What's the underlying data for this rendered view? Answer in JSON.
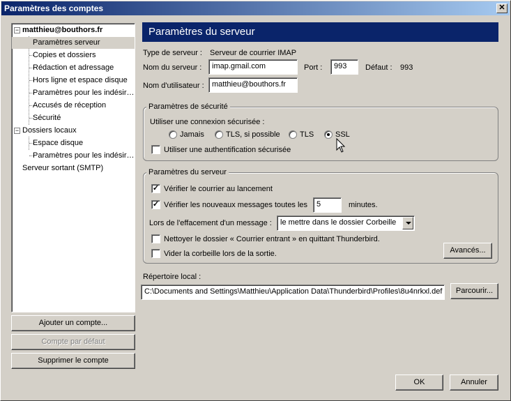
{
  "window": {
    "title": "Paramètres des comptes",
    "close_label": "✕"
  },
  "sidebar": {
    "account": "matthieu@bouthors.fr",
    "account_items": [
      "Paramètres serveur",
      "Copies et dossiers",
      "Rédaction et adressage",
      "Hors ligne et espace disque",
      "Paramètres pour les indésir…",
      "Accusés de réception",
      "Sécurité"
    ],
    "local_folders": "Dossiers locaux",
    "local_items": [
      "Espace disque",
      "Paramètres pour les indésir…"
    ],
    "smtp": "Serveur sortant (SMTP)",
    "add_account": "Ajouter un compte...",
    "default_account": "Compte par défaut",
    "delete_account": "Supprimer le compte"
  },
  "main": {
    "header": "Paramètres du serveur",
    "server_type_label": "Type de serveur :",
    "server_type_value": "Serveur de courrier IMAP",
    "server_name_label": "Nom du serveur :",
    "server_name_value": "imap.gmail.com",
    "port_label": "Port :",
    "port_value": "993",
    "default_label": "Défaut :",
    "default_value": "993",
    "username_label": "Nom d'utilisateur :",
    "username_value": "matthieu@bouthors.fr",
    "security": {
      "title": "Paramètres de sécurité",
      "connection_label": "Utiliser une connexion sécurisée :",
      "options": [
        "Jamais",
        "TLS, si possible",
        "TLS",
        "SSL"
      ],
      "selected": "SSL",
      "secure_auth_label": "Utiliser une authentification sécurisée",
      "secure_auth_checked": false
    },
    "server": {
      "title": "Paramètres du serveur",
      "check_on_start_label": "Vérifier le courrier au lancement",
      "check_on_start": true,
      "check_every_label": "Vérifier les nouveaux messages toutes les",
      "check_every": true,
      "minutes_value": "5",
      "minutes_label": "minutes.",
      "on_delete_label": "Lors de l'effacement d'un message :",
      "on_delete_value": "le mettre dans le dossier Corbeille",
      "clean_inbox_label": "Nettoyer le dossier « Courrier entrant » en quittant Thunderbird.",
      "clean_inbox": false,
      "empty_trash_label": "Vider la corbeille lors de la sortie.",
      "empty_trash": false,
      "advanced_label": "Avancés..."
    },
    "local_dir_label": "Répertoire local :",
    "local_dir_value": "C:\\Documents and Settings\\Matthieu\\Application Data\\Thunderbird\\Profiles\\8u4nrkxl.def",
    "browse_label": "Parcourir..."
  },
  "footer": {
    "ok": "OK",
    "cancel": "Annuler"
  },
  "colors": {
    "title_start": "#0a246a",
    "title_end": "#a6caf0",
    "face": "#d4d0c8",
    "header_bg": "#0a246a"
  }
}
